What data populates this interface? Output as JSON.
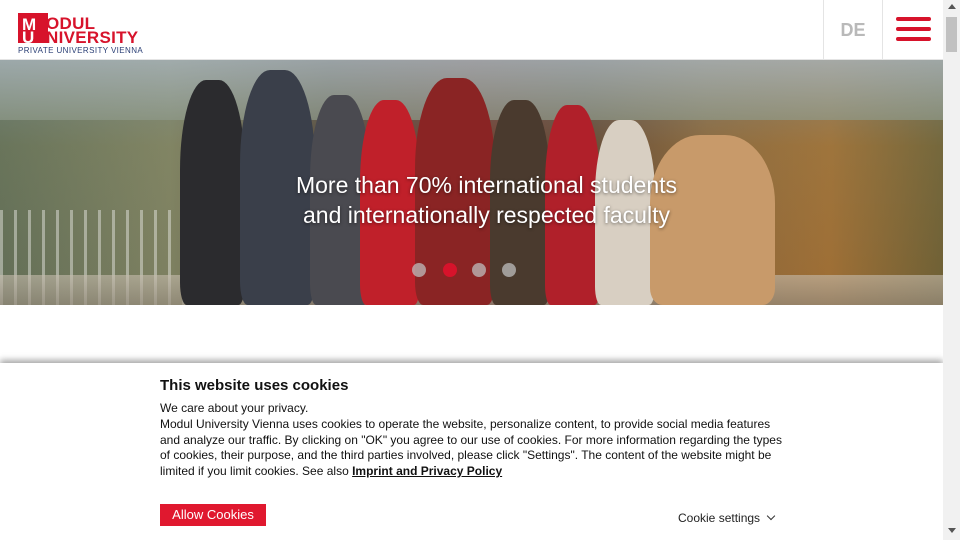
{
  "header": {
    "logo_line1": "ODUL",
    "logo_line2": "NIVERSITY",
    "logo_m": "M",
    "logo_u": "U",
    "logo_subtitle": "PRIVATE UNIVERSITY VIENNA",
    "lang_label": "DE",
    "menu_icon": "hamburger-menu-icon",
    "brand_color": "#d7132b"
  },
  "hero": {
    "title_line1": "More than 70% international students",
    "title_line2": "and internationally respected faculty",
    "slides": 4,
    "active_slide": 2
  },
  "cookie": {
    "title": "This website uses cookies",
    "intro": "We care about your privacy.",
    "body": "Modul University Vienna uses cookies to operate the website, personalize content, to provide social media features and analyze our traffic. By clicking on \"OK\" you agree to our use of cookies. For more information regarding the types of cookies, their purpose, and the third parties involved, please click \"Settings\". The content of the website might be limited if you limit cookies. See also ",
    "link_label": "Imprint and Privacy Policy",
    "allow_label": "Allow Cookies",
    "settings_label": "Cookie settings"
  }
}
